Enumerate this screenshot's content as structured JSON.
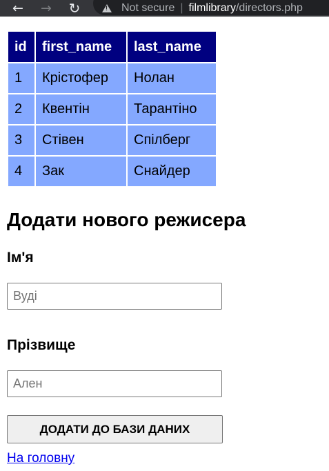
{
  "browser": {
    "security_label": "Not secure",
    "separator": "|",
    "url_host": "filmlibrary",
    "url_path": "/directors.php",
    "icons": [
      "back-arrow-icon",
      "forward-arrow-icon",
      "reload-icon",
      "warning-icon"
    ]
  },
  "table": {
    "headers": [
      "id",
      "first_name",
      "last_name"
    ],
    "rows": [
      [
        "1",
        "Крістофер",
        "Нолан"
      ],
      [
        "2",
        "Квентін",
        "Тарантіно"
      ],
      [
        "3",
        "Стівен",
        "Спілберг"
      ],
      [
        "4",
        "Зак",
        "Снайдер"
      ]
    ],
    "colors": {
      "header_bg": "#000080",
      "cell_bg": "#84a8ff"
    }
  },
  "form": {
    "title": "Додати нового режисера",
    "first_name_label": "Ім'я",
    "first_name_placeholder": "Вуді",
    "first_name_value": "",
    "last_name_label": "Прізвище",
    "last_name_placeholder": "Ален",
    "last_name_value": "",
    "submit_label": "ДОДАТИ ДО БАЗИ ДАНИХ"
  },
  "links": {
    "home": "На головну"
  }
}
